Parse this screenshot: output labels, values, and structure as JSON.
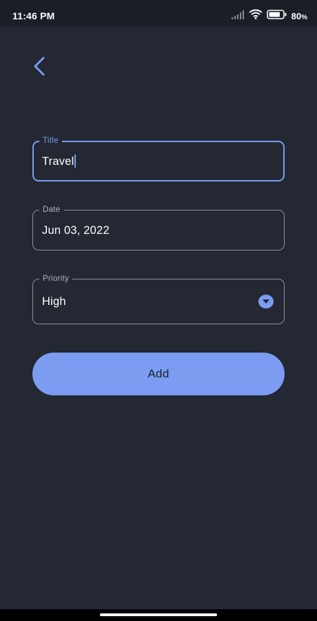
{
  "status_bar": {
    "time": "11:46 PM",
    "battery_percent": "80",
    "battery_unit": "%",
    "battery_level": 0.8,
    "icons": [
      "signal-icon",
      "wifi-icon",
      "battery-icon"
    ]
  },
  "header": {
    "back_icon": "chevron-left-icon"
  },
  "form": {
    "title": {
      "label": "Title",
      "value": "Travel"
    },
    "date": {
      "label": "Date",
      "value": "Jun 03, 2022"
    },
    "priority": {
      "label": "Priority",
      "value": "High",
      "icon": "dropdown-arrow-icon"
    }
  },
  "actions": {
    "add_label": "Add"
  },
  "colors": {
    "background": "#232833",
    "accent": "#7b9cf0",
    "outline": "#8c919b",
    "text": "#ffffff"
  }
}
